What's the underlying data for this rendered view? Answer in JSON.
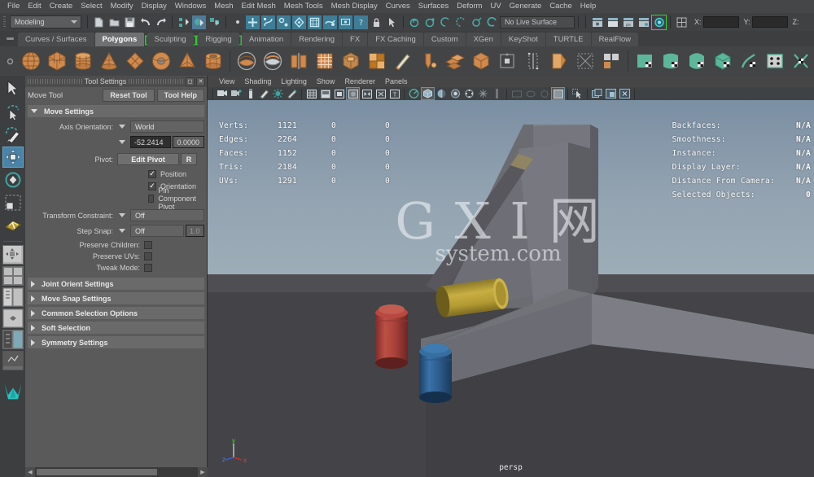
{
  "menubar": {
    "items": [
      "File",
      "Edit",
      "Create",
      "Select",
      "Modify",
      "Display",
      "Windows",
      "Mesh",
      "Edit Mesh",
      "Mesh Tools",
      "Mesh Display",
      "Curves",
      "Surfaces",
      "Deform",
      "UV",
      "Generate",
      "Cache",
      "Help"
    ]
  },
  "statusbar": {
    "mode": "Modeling",
    "live_surface": "No Live Surface",
    "x_label": "X:",
    "y_label": "Y:",
    "z_label": "Z:",
    "x_value": "",
    "y_value": "",
    "z_value": ""
  },
  "shelf": {
    "tabs": [
      {
        "label": "Curves / Surfaces",
        "active": false,
        "bracket": "none"
      },
      {
        "label": "Polygons",
        "active": true,
        "bracket": "none"
      },
      {
        "label": "Sculpting",
        "active": false,
        "bracket": "both"
      },
      {
        "label": "Rigging",
        "active": false,
        "bracket": "both"
      },
      {
        "label": "Animation",
        "active": false,
        "bracket": "none"
      },
      {
        "label": "Rendering",
        "active": false,
        "bracket": "none"
      },
      {
        "label": "FX",
        "active": false,
        "bracket": "none"
      },
      {
        "label": "FX Caching",
        "active": false,
        "bracket": "none"
      },
      {
        "label": "Custom",
        "active": false,
        "bracket": "none"
      },
      {
        "label": "XGen",
        "active": false,
        "bracket": "none"
      },
      {
        "label": "KeyShot",
        "active": false,
        "bracket": "none"
      },
      {
        "label": "TURTLE",
        "active": false,
        "bracket": "none"
      },
      {
        "label": "RealFlow",
        "active": false,
        "bracket": "none"
      }
    ],
    "icons": [
      "poly-sphere-icon",
      "poly-cube-icon",
      "poly-cylinder-icon",
      "poly-cone-icon",
      "poly-plane-icon",
      "poly-torus-icon",
      "poly-pyramid-icon",
      "poly-pipe-icon",
      "poly-booleans-union-icon",
      "poly-booleans-difference-icon",
      "poly-combine-icon",
      "poly-smooth-icon",
      "poly-extrude-icon",
      "poly-bevel-icon",
      "poly-bridge-icon",
      "poly-append-icon",
      "poly-multicut-icon",
      "poly-target-weld-icon",
      "poly-reduce-icon",
      "poly-triangulate-icon",
      "poly-quadrangulate-icon",
      "poly-mirror-icon",
      "poly-merge-icon",
      "poly-separate-icon",
      "uv-planar-icon",
      "uv-cylindrical-icon",
      "uv-spherical-icon",
      "uv-automatic-icon",
      "uv-unfold-icon",
      "uv-editor-icon",
      "uv-layout-icon"
    ]
  },
  "toolbox": {
    "items": [
      {
        "name": "select-tool",
        "selected": false
      },
      {
        "name": "lasso-select-tool",
        "selected": false
      },
      {
        "name": "paint-select-tool",
        "selected": false
      },
      {
        "name": "move-tool",
        "selected": true
      },
      {
        "name": "rotate-tool",
        "selected": false
      },
      {
        "name": "scale-tool",
        "selected": false
      },
      {
        "name": "last-tool-used",
        "selected": false
      },
      {
        "name": "single-perspective-view",
        "selected": false
      },
      {
        "name": "four-view-layout",
        "selected": false
      },
      {
        "name": "two-panes-side-by-side",
        "selected": false
      },
      {
        "name": "persp-outliner-layout",
        "selected": false
      },
      {
        "name": "hypershade-persp-layout",
        "selected": false
      },
      {
        "name": "persp-graph-layout",
        "selected": false
      },
      {
        "name": "single-perspective-view-2",
        "selected": false
      },
      {
        "name": "maya-logo-icon",
        "selected": false
      }
    ]
  },
  "tool_settings": {
    "panel_title": "Tool Settings",
    "tool_name": "Move Tool",
    "reset_button": "Reset Tool",
    "help_button": "Tool Help",
    "restore_icon": "restore-window-icon",
    "close_icon": "close-window-icon",
    "move_settings": {
      "title": "Move Settings",
      "axis_orientation_label": "Axis Orientation:",
      "axis_orientation_value": "World",
      "axis_num_1": "-52.2414",
      "axis_num_2": "0.0000",
      "pivot_label": "Pivot:",
      "edit_pivot_button": "Edit Pivot",
      "reset_pivot_button": "R",
      "checkboxes": [
        {
          "label": "Position",
          "checked": true
        },
        {
          "label": "Orientation",
          "checked": true
        },
        {
          "label": "Pin Component Pivot",
          "checked": false
        }
      ],
      "transform_constraint_label": "Transform Constraint:",
      "transform_constraint_value": "Off",
      "step_snap_label": "Step Snap:",
      "step_snap_value": "Off",
      "step_snap_amount": "1.0",
      "small_toggles": [
        {
          "label": "Preserve Children:",
          "checked": false
        },
        {
          "label": "Preserve UVs:",
          "checked": false
        },
        {
          "label": "Tweak Mode:",
          "checked": false
        }
      ]
    },
    "collapsed_sections": [
      "Joint Orient Settings",
      "Move Snap Settings",
      "Common Selection Options",
      "Soft Selection",
      "Symmetry Settings"
    ]
  },
  "viewport": {
    "menus": [
      "View",
      "Shading",
      "Lighting",
      "Show",
      "Renderer",
      "Panels"
    ],
    "toolbar_icons": [
      "camera-attributes-icon",
      "camera-bookmarks-icon",
      "image-plane-icon",
      "two-sided-lighting-icon",
      "shadows-icon",
      "light-icon",
      "wireframe-icon",
      "smooth-shade-all-icon",
      "shaded-mode-icon",
      "textured-mode-icon",
      "use-all-lights-icon",
      "xray-icon",
      "xray-joints-icon",
      "isolate-select-icon",
      "grid-toggle-icon",
      "film-gate-icon",
      "resolution-gate-icon",
      "gate-mask-icon",
      "exposure-icon",
      "gamma-icon",
      "viewport-render-icon",
      "display-layer-icon",
      "snapshot-icon",
      "open-render-view-icon"
    ],
    "hud_left": {
      "rows": [
        {
          "label": "Verts:",
          "total": "1121",
          "b": "0",
          "c": "0"
        },
        {
          "label": "Edges:",
          "total": "2264",
          "b": "0",
          "c": "0"
        },
        {
          "label": "Faces:",
          "total": "1152",
          "b": "0",
          "c": "0"
        },
        {
          "label": "Tris:",
          "total": "2184",
          "b": "0",
          "c": "0"
        },
        {
          "label": "UVs:",
          "total": "1291",
          "b": "0",
          "c": "0"
        }
      ]
    },
    "hud_right": {
      "rows": [
        {
          "label": "Backfaces:",
          "value": "N/A"
        },
        {
          "label": "Smoothness:",
          "value": "N/A"
        },
        {
          "label": "Instance:",
          "value": "N/A"
        },
        {
          "label": "Display Layer:",
          "value": "N/A"
        },
        {
          "label": "Distance From Camera:",
          "value": "N/A"
        },
        {
          "label": "Selected Objects:",
          "value": "0"
        }
      ]
    },
    "camera_label": "persp",
    "axis_gizmo": {
      "x": "x",
      "y": "y",
      "z": "z"
    },
    "watermark": {
      "line1": "G X I 网",
      "line2": "system.com"
    },
    "scene_objects": [
      {
        "name": "red-cylinder",
        "color": "#a8453f"
      },
      {
        "name": "blue-cylinder",
        "color": "#2f5f90"
      },
      {
        "name": "gold-cylinder",
        "color": "#b09a33"
      },
      {
        "name": "grey-wedge-block",
        "color": "#6e6e74"
      },
      {
        "name": "grey-slab",
        "color": "#7a7a80"
      }
    ]
  },
  "colors": {
    "accent_blue": "#4a83a8",
    "shelf_orange": "#d38b4a",
    "shelf_green": "#5cb79a",
    "bracket_green": "#35c435",
    "panel_bg": "#5a5a5a",
    "window_bg": "#3c3e40"
  }
}
